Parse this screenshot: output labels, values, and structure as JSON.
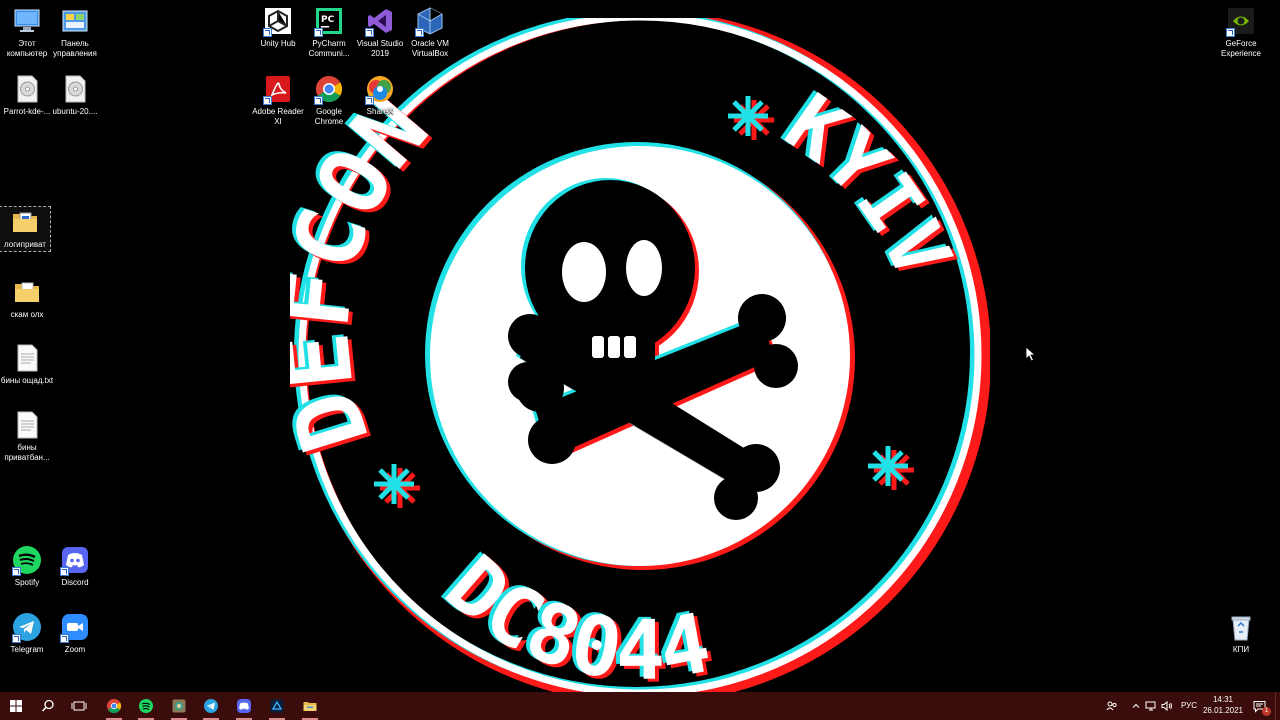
{
  "desktop": {
    "icons": [
      {
        "label": "Этот компьютер"
      },
      {
        "label": "Панель управления"
      },
      {
        "label": "Parrot-kde-..."
      },
      {
        "label": "ubuntu-20...."
      },
      {
        "label": "логиприват"
      },
      {
        "label": "скам олх"
      },
      {
        "label": "бины ощад.txt"
      },
      {
        "label": "бины приватбан..."
      },
      {
        "label": "Spotify"
      },
      {
        "label": "Discord"
      },
      {
        "label": "Telegram"
      },
      {
        "label": "Zoom"
      },
      {
        "label": "Unity Hub"
      },
      {
        "label": "PyCharm Communi..."
      },
      {
        "label": "Visual Studio 2019"
      },
      {
        "label": "Oracle VM VirtualBox"
      },
      {
        "label": "Adobe Reader XI"
      },
      {
        "label": "Google Chrome"
      },
      {
        "label": "ShareX"
      },
      {
        "label": "GeForce Experience"
      },
      {
        "label": "КПИ"
      }
    ]
  },
  "wallpaper": {
    "top_text": "DEFCON",
    "right_text": "KYIV",
    "bottom_text": "DC8044"
  },
  "taskbar": {
    "pinned": [
      {
        "icon": "chrome-icon"
      },
      {
        "icon": "spotify-icon"
      },
      {
        "icon": "app-icon"
      },
      {
        "icon": "telegram-icon"
      },
      {
        "icon": "discord-icon"
      },
      {
        "icon": "app-dark-icon"
      },
      {
        "icon": "file-explorer-icon"
      }
    ],
    "tray": {
      "language": "РУС",
      "time": "14:31",
      "date": "26.01.2021",
      "notification_count": "1"
    }
  },
  "colors": {
    "taskbar_bg": "#3b0c0c",
    "glitch_red": "#ff1a1a",
    "glitch_cyan": "#21e0e6"
  }
}
